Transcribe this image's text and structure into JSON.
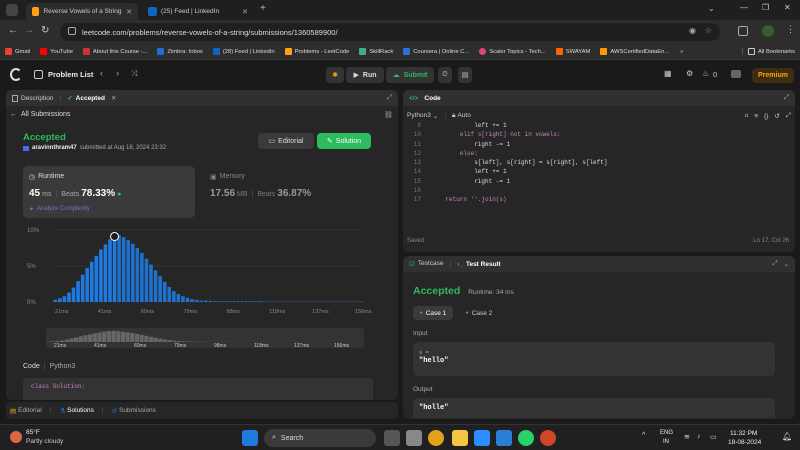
{
  "browser": {
    "tabs": [
      {
        "title": "Reverse Vowels of a String - Lee",
        "active": true
      },
      {
        "title": "(25) Feed | LinkedIn",
        "active": false
      }
    ],
    "url": "leetcode.com/problems/reverse-vowels-of-a-string/submissions/1360589900/",
    "bookmarks": [
      "Gmail",
      "YouTube",
      "About this Course -...",
      "Zimbra: Inbox",
      "(28) Feed | LinkedIn",
      "Problems - LeetCode",
      "SkillRack",
      "Coursera | Online C...",
      "Scaler Topics - Tech...",
      "SWAYAM",
      "AWSCertifiedDataEn..."
    ],
    "all_bookmarks": "All Bookmarks"
  },
  "nav": {
    "problem_list": "Problem List",
    "run": "Run",
    "submit": "Submit",
    "fire_count": "0",
    "premium": "Premium"
  },
  "left": {
    "tab_description": "Description",
    "tab_accepted": "Accepted",
    "all_submissions": "All Submissions",
    "status": "Accepted",
    "user": "aravinnthram47",
    "submitted": "submitted at Aug 18, 2024 23:32",
    "editorial": "Editorial",
    "solution": "Solution",
    "runtime_label": "Runtime",
    "runtime_value": "45",
    "runtime_unit": "ms",
    "beats_label": "Beats",
    "beats_value": "78.33%",
    "analyze": "Analyze Complexity",
    "memory_label": "Memory",
    "memory_value": "17.56",
    "memory_unit": "MB",
    "mem_beats_label": "Beats",
    "mem_beats_value": "36.87%",
    "code_label": "Code",
    "code_lang": "Python3",
    "code_first": "class Solution:",
    "bottom_tabs": [
      "Editorial",
      "Solutions",
      "Submissions"
    ]
  },
  "chart_data": {
    "type": "bar",
    "ylabel": "",
    "xlabel": "",
    "ytick_labels": [
      "10%",
      "5%",
      "0%"
    ],
    "xtick_labels": [
      "21ms",
      "41ms",
      "60ms",
      "79ms",
      "98ms",
      "118ms",
      "137ms",
      "156ms"
    ],
    "mini_xtick_labels": [
      "21ms",
      "41ms",
      "60ms",
      "79ms",
      "98ms",
      "118ms",
      "137ms",
      "156ms"
    ],
    "ylim": [
      0,
      10
    ],
    "highlight_index": 13,
    "values": [
      0.3,
      0.5,
      0.8,
      1.3,
      2.0,
      2.9,
      3.8,
      4.7,
      5.6,
      6.4,
      7.3,
      8.0,
      8.7,
      9.1,
      9.3,
      9.0,
      8.6,
      8.1,
      7.5,
      6.8,
      6.0,
      5.2,
      4.4,
      3.6,
      2.8,
      2.1,
      1.5,
      1.1,
      0.8,
      0.6,
      0.4,
      0.3,
      0.2,
      0.2,
      0.15,
      0.1,
      0.1,
      0.1,
      0.1,
      0.1,
      0.1,
      0.1,
      0.1,
      0.1,
      0.1,
      0.1,
      0.05,
      0.05,
      0.05,
      0.05,
      0.05,
      0.05,
      0.05,
      0.05,
      0.05,
      0.05,
      0.05,
      0.05,
      0.05,
      0.05,
      0.05,
      0.05,
      0.05,
      0.05,
      0.05,
      0.05,
      0.05,
      0.05
    ]
  },
  "code_panel": {
    "title": "Code",
    "lang": "Python3",
    "auto": "Auto",
    "lines": [
      {
        "n": "9",
        "indent": 3,
        "text": "left += 1"
      },
      {
        "n": "10",
        "indent": 2,
        "text": "elif s[right] not in vowels:"
      },
      {
        "n": "11",
        "indent": 3,
        "text": "right -= 1"
      },
      {
        "n": "12",
        "indent": 2,
        "text": "else:"
      },
      {
        "n": "13",
        "indent": 3,
        "text": "s[left], s[right] = s[right], s[left]"
      },
      {
        "n": "14",
        "indent": 3,
        "text": "left += 1"
      },
      {
        "n": "15",
        "indent": 3,
        "text": "right -= 1"
      },
      {
        "n": "16",
        "indent": 0,
        "text": ""
      },
      {
        "n": "17",
        "indent": 1,
        "text": "return ''.join(s)"
      }
    ],
    "saved": "Saved",
    "cursor": "Ln 17, Col 26"
  },
  "result": {
    "tab_testcase": "Testcase",
    "tab_result": "Test Result",
    "status": "Accepted",
    "runtime": "Runtime: 34 ms",
    "case1": "Case 1",
    "case2": "Case 2",
    "input_label": "Input",
    "input_var": "s =",
    "input_value": "\"hello\"",
    "output_label": "Output",
    "output_value": "\"holle\""
  },
  "taskbar": {
    "temp": "85°F",
    "weather": "Partly cloudy",
    "search": "Search",
    "lang1": "ENG",
    "lang2": "IN",
    "time": "11:32 PM",
    "date": "18-08-2024"
  },
  "colors": {
    "green": "#2cbb5d",
    "blue": "#1f7ae0",
    "orange": "#ffa116"
  }
}
